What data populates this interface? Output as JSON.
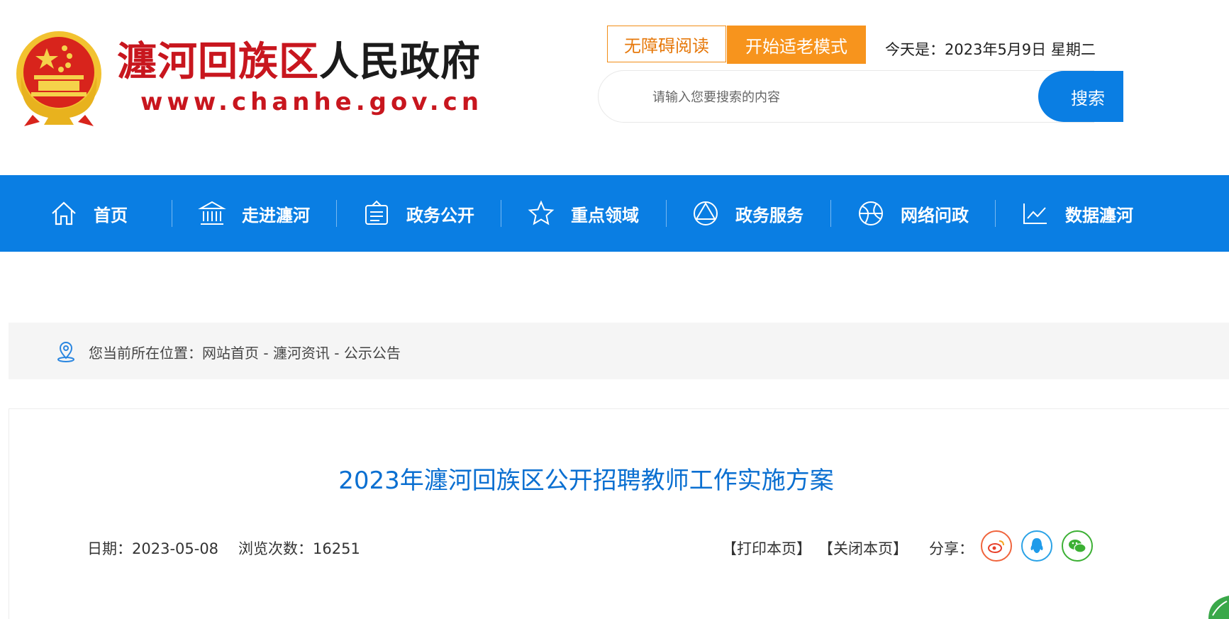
{
  "header": {
    "site_name_red": "瀍河回族区",
    "site_name_dark": "人民政府",
    "site_url": "www.chanhe.gov.cn",
    "accessibility_button": "无障碍阅读",
    "elder_mode_button": "开始适老模式",
    "date_text": "今天是：2023年5月9日 星期二",
    "search_placeholder": "请输入您要搜索的内容",
    "search_button": "搜索"
  },
  "nav": {
    "items": [
      {
        "label": "首页",
        "icon": "home-icon"
      },
      {
        "label": "走进瀍河",
        "icon": "building-icon"
      },
      {
        "label": "政务公开",
        "icon": "document-icon"
      },
      {
        "label": "重点领域",
        "icon": "star-icon"
      },
      {
        "label": "政务服务",
        "icon": "triangle-service-icon"
      },
      {
        "label": "网络问政",
        "icon": "globe-icon"
      },
      {
        "label": "数据瀍河",
        "icon": "line-chart-icon"
      }
    ]
  },
  "breadcrumb": {
    "prefix": "您当前所在位置：",
    "items": [
      "网站首页",
      "瀍河资讯",
      "公示公告"
    ],
    "separator": " - "
  },
  "article": {
    "title": "2023年瀍河回族区公开招聘教师工作实施方案",
    "date": "日期：2023-05-08",
    "views": "浏览次数：16251",
    "print": "【打印本页】",
    "close": "【关闭本页】",
    "share_label": "分享："
  },
  "share": [
    "weibo-icon",
    "qq-icon",
    "wechat-icon"
  ],
  "colors": {
    "brand_blue": "#0a7ee3",
    "brand_red": "#c8161e",
    "accent_orange": "#f7941d",
    "title_blue": "#0a6fd1"
  }
}
